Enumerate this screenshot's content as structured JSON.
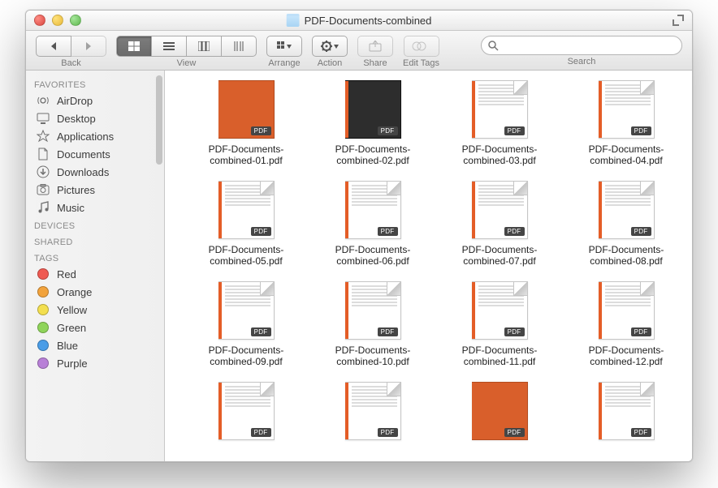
{
  "window": {
    "title": "PDF-Documents-combined"
  },
  "toolbar": {
    "back_label": "Back",
    "view_label": "View",
    "arrange_label": "Arrange",
    "action_label": "Action",
    "share_label": "Share",
    "tags_label": "Edit Tags",
    "search_label": "Search",
    "search_placeholder": ""
  },
  "sidebar": {
    "favorites_header": "FAVORITES",
    "devices_header": "DEVICES",
    "shared_header": "SHARED",
    "tags_header": "TAGS",
    "favorites": [
      {
        "label": "AirDrop",
        "icon": "airdrop"
      },
      {
        "label": "Desktop",
        "icon": "desktop"
      },
      {
        "label": "Applications",
        "icon": "apps"
      },
      {
        "label": "Documents",
        "icon": "documents"
      },
      {
        "label": "Downloads",
        "icon": "downloads"
      },
      {
        "label": "Pictures",
        "icon": "pictures"
      },
      {
        "label": "Music",
        "icon": "music"
      }
    ],
    "tags": [
      {
        "label": "Red",
        "color": "#ef5a52"
      },
      {
        "label": "Orange",
        "color": "#f2a33c"
      },
      {
        "label": "Yellow",
        "color": "#f3df4f"
      },
      {
        "label": "Green",
        "color": "#8fd45a"
      },
      {
        "label": "Blue",
        "color": "#4a9de7"
      },
      {
        "label": "Purple",
        "color": "#b880d7"
      }
    ]
  },
  "files": [
    {
      "name": "PDF-Documents-combined-01.pdf",
      "style": "full",
      "badge": "PDF"
    },
    {
      "name": "PDF-Documents-combined-02.pdf",
      "style": "dark",
      "badge": "PDF"
    },
    {
      "name": "PDF-Documents-combined-03.pdf",
      "style": "page",
      "badge": "PDF"
    },
    {
      "name": "PDF-Documents-combined-04.pdf",
      "style": "page",
      "badge": "PDF"
    },
    {
      "name": "PDF-Documents-combined-05.pdf",
      "style": "page",
      "badge": "PDF"
    },
    {
      "name": "PDF-Documents-combined-06.pdf",
      "style": "page",
      "badge": "PDF"
    },
    {
      "name": "PDF-Documents-combined-07.pdf",
      "style": "page",
      "badge": "PDF"
    },
    {
      "name": "PDF-Documents-combined-08.pdf",
      "style": "page",
      "badge": "PDF"
    },
    {
      "name": "PDF-Documents-combined-09.pdf",
      "style": "page",
      "badge": "PDF"
    },
    {
      "name": "PDF-Documents-combined-10.pdf",
      "style": "page",
      "badge": "PDF"
    },
    {
      "name": "PDF-Documents-combined-11.pdf",
      "style": "page",
      "badge": "PDF"
    },
    {
      "name": "PDF-Documents-combined-12.pdf",
      "style": "page",
      "badge": "PDF"
    },
    {
      "name": "",
      "style": "page",
      "badge": "PDF"
    },
    {
      "name": "",
      "style": "page",
      "badge": "PDF"
    },
    {
      "name": "",
      "style": "full",
      "badge": "PDF"
    },
    {
      "name": "",
      "style": "page",
      "badge": "PDF"
    }
  ]
}
